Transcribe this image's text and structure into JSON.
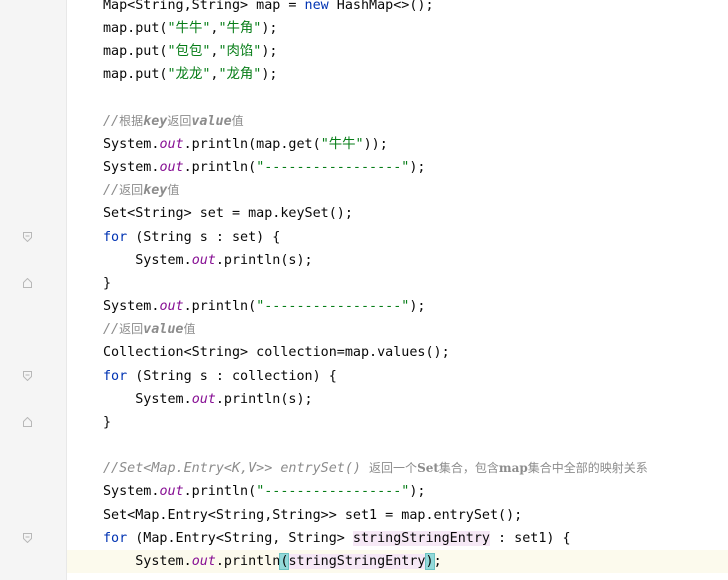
{
  "code": {
    "l1": {
      "a": "Map<String,String> map = ",
      "b": "new",
      "c": " HashMap<>();"
    },
    "l2": {
      "a": "map.put(",
      "b": "\"牛牛\"",
      "c": ",",
      "d": "\"牛角\"",
      "e": ");"
    },
    "l3": {
      "a": "map.put(",
      "b": "\"包包\"",
      "c": ",",
      "d": "\"肉馅\"",
      "e": ");"
    },
    "l4": {
      "a": "map.put(",
      "b": "\"龙龙\"",
      "c": ",",
      "d": "\"龙角\"",
      "e": ");"
    },
    "l6": {
      "a": "//",
      "b": "根据",
      "c": "key",
      "d": "返回",
      "e": "value",
      "f": "值"
    },
    "l7": {
      "a": "System.",
      "b": "out",
      "c": ".println(map.get(",
      "d": "\"牛牛\"",
      "e": "));"
    },
    "l8": {
      "a": "System.",
      "b": "out",
      "c": ".println(",
      "d": "\"-----------------\"",
      "e": ");"
    },
    "l9": {
      "a": "//",
      "b": "返回",
      "c": "key",
      "d": "值"
    },
    "l10": {
      "a": "Set<String> set = map.keySet();"
    },
    "l11": {
      "a": "for",
      "b": " (String s : set) {"
    },
    "l12": {
      "a": "    System.",
      "b": "out",
      "c": ".println(s);"
    },
    "l13": {
      "a": "}"
    },
    "l14": {
      "a": "System.",
      "b": "out",
      "c": ".println(",
      "d": "\"-----------------\"",
      "e": ");"
    },
    "l15": {
      "a": "//",
      "b": "返回",
      "c": "value",
      "d": "值"
    },
    "l16": {
      "a": "Collection<String> collection=map.values();"
    },
    "l17": {
      "a": "for",
      "b": " (String s : collection) {"
    },
    "l18": {
      "a": "    System.",
      "b": "out",
      "c": ".println(s);"
    },
    "l19": {
      "a": "}"
    },
    "l21": {
      "a": "//Set<Map.Entry<K,V>> entrySet() ",
      "b": "返回一个",
      "c": "Set",
      "d": "集合，包含",
      "e": "map",
      "f": "集合中全部的映射关系"
    },
    "l22": {
      "a": "System.",
      "b": "out",
      "c": ".println(",
      "d": "\"-----------------\"",
      "e": ");"
    },
    "l23": {
      "a": "Set<Map.Entry<String,String>> set1 = map.entrySet();"
    },
    "l24": {
      "a": "for",
      "b": " (Map.Entry<String, String> ",
      "c": "stringStringEntry",
      "d": " : set1) {"
    },
    "l25": {
      "a": "    System.",
      "b": "out",
      "c": ".println",
      "d": "(",
      "e": "stringStringEntry",
      "f": ")",
      ";": ";"
    }
  },
  "colors": {
    "keyword": "#0033b3",
    "string": "#067d17",
    "field": "#871094",
    "comment": "#8c8c8c"
  }
}
